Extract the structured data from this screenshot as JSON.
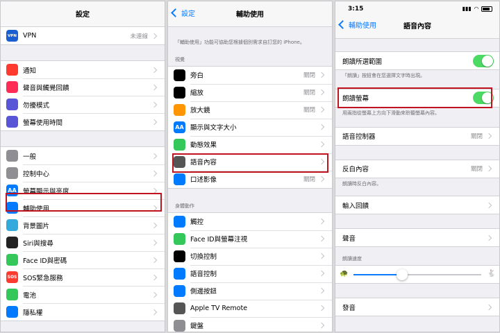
{
  "panel1": {
    "title": "設定",
    "vpn": {
      "label": "VPN",
      "value": "未連線",
      "icon_text": "VPN"
    },
    "group2": [
      {
        "label": "通知",
        "icon": "notifications-icon",
        "color": "#ff3b30"
      },
      {
        "label": "聲音與觸覺回饋",
        "icon": "sound-icon",
        "color": "#ff2d55"
      },
      {
        "label": "勿擾模式",
        "icon": "moon-icon",
        "color": "#5856d6"
      },
      {
        "label": "螢幕使用時間",
        "icon": "hourglass-icon",
        "color": "#5856d6"
      }
    ],
    "group3": [
      {
        "label": "一般",
        "icon": "gear-icon",
        "color": "#8e8e93"
      },
      {
        "label": "控制中心",
        "icon": "toggles-icon",
        "color": "#8e8e93"
      },
      {
        "label": "螢幕顯示與亮度",
        "icon": "display-icon",
        "color": "#007aff",
        "icon_text": "AA"
      },
      {
        "label": "輔助使用",
        "icon": "accessibility-icon",
        "color": "#007aff"
      },
      {
        "label": "背景圖片",
        "icon": "wallpaper-icon",
        "color": "#34aadc"
      },
      {
        "label": "Siri與搜尋",
        "icon": "siri-icon",
        "color": "#222222"
      },
      {
        "label": "Face ID與密碼",
        "icon": "faceid-icon",
        "color": "#34c759"
      },
      {
        "label": "SOS緊急服務",
        "icon": "sos-icon",
        "color": "#ff3b30",
        "icon_text": "SOS"
      },
      {
        "label": "電池",
        "icon": "battery-icon",
        "color": "#34c759"
      },
      {
        "label": "隱私權",
        "icon": "hand-icon",
        "color": "#007aff"
      }
    ]
  },
  "panel2": {
    "back": "設定",
    "title": "輔助使用",
    "intro": "「輔助使用」功能可協助您根據個別需求自訂您的 iPhone。",
    "section_vision": "視覺",
    "vision": [
      {
        "label": "旁白",
        "value": "關閉",
        "icon": "voiceover-icon",
        "color": "#000000"
      },
      {
        "label": "縮放",
        "value": "關閉",
        "icon": "zoom-icon",
        "color": "#000000"
      },
      {
        "label": "放大鏡",
        "value": "關閉",
        "icon": "magnifier-icon",
        "color": "#ff9500"
      },
      {
        "label": "顯示與文字大小",
        "value": "",
        "icon": "text-size-icon",
        "color": "#007aff",
        "icon_text": "AA"
      },
      {
        "label": "動態效果",
        "value": "",
        "icon": "motion-icon",
        "color": "#34c759"
      },
      {
        "label": "語音內容",
        "value": "",
        "icon": "speech-icon",
        "color": "#555555"
      },
      {
        "label": "口述影像",
        "value": "關閉",
        "icon": "audio-description-icon",
        "color": "#007aff"
      }
    ],
    "section_motor": "身體動作",
    "motor": [
      {
        "label": "觸控",
        "icon": "touch-icon",
        "color": "#007aff"
      },
      {
        "label": "Face ID與螢幕注視",
        "icon": "faceid-attention-icon",
        "color": "#34c759"
      },
      {
        "label": "切換控制",
        "icon": "switch-control-icon",
        "color": "#000000"
      },
      {
        "label": "語音控制",
        "icon": "voice-control-icon",
        "color": "#007aff"
      },
      {
        "label": "側邊按鈕",
        "icon": "side-button-icon",
        "color": "#007aff"
      },
      {
        "label": "Apple TV Remote",
        "icon": "remote-icon",
        "color": "#555555"
      },
      {
        "label": "鍵盤",
        "icon": "keyboard-icon",
        "color": "#8e8e93"
      }
    ]
  },
  "panel3": {
    "status_time": "3:15",
    "back": "輔助使用",
    "title": "語音內容",
    "speak_selection": "朗讀所選範圍",
    "speak_selection_note": "「朗讀」按鈕會在您選擇文字時出現。",
    "speak_screen": "朗讀螢幕",
    "speak_screen_note": "用兩指從螢幕上方向下滑動來聆聽螢幕內容。",
    "speech_controller": {
      "label": "語音控制器",
      "value": "關閉"
    },
    "highlight_content": {
      "label": "反白內容",
      "value": "關閉"
    },
    "highlight_note": "朗讀時反白內容。",
    "typing_feedback": "輸入回饋",
    "voices": "聲音",
    "rate_header": "朗讀速度",
    "speaking_rate": 0.38,
    "pronunciations": "發音"
  },
  "colors": {
    "accent": "#0a7aff",
    "toggle_on": "#4cd964",
    "highlight": "#c0131f"
  }
}
